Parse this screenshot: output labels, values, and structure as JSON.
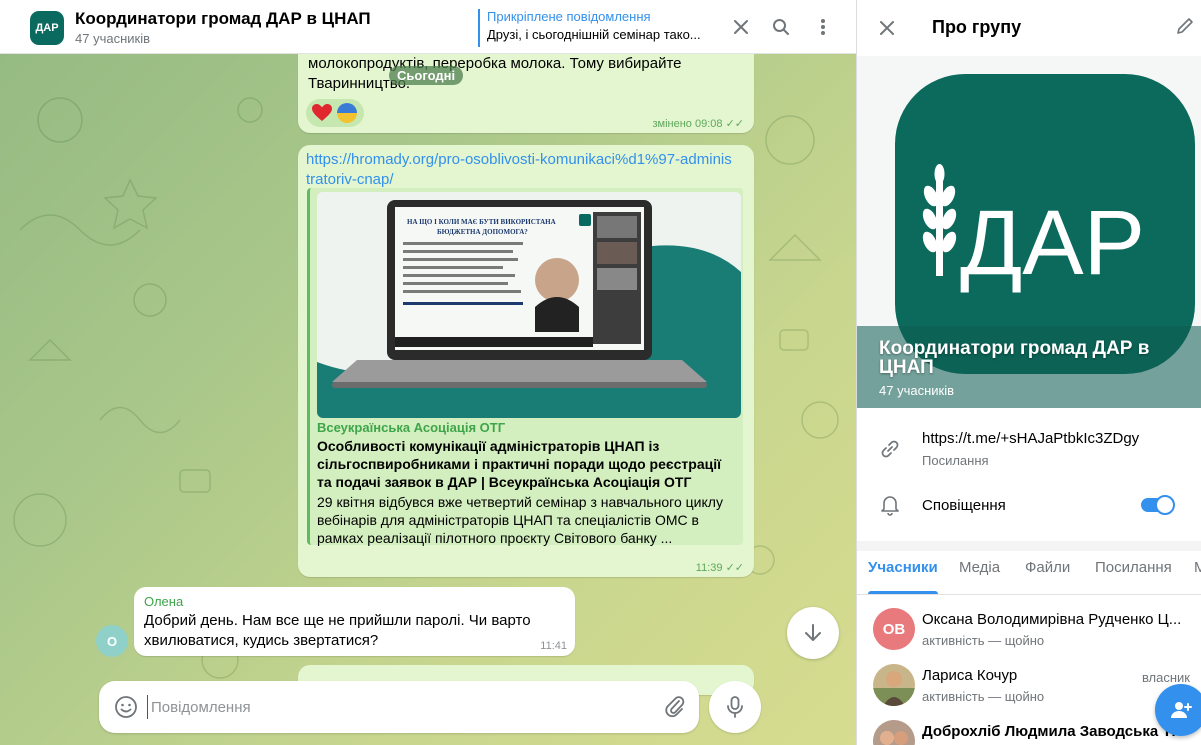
{
  "header": {
    "avatar_text": "ДАР",
    "title": "Координатори громад ДАР в ЦНАП",
    "subtitle": "47 учасників",
    "pinned_title": "Прикріплене повідомлення",
    "pinned_text": "Друзі, і сьогоднішній семінар тако..."
  },
  "chat": {
    "date_divider": "Сьогодні",
    "msg1": {
      "text_line1": "молокопродуктів, переробка молока. Тому вибирайте",
      "text_line2": "Тваринництво.",
      "meta": "змінено 09:08",
      "reactions": [
        "heart",
        "ukraine-flag-ball"
      ]
    },
    "msg2": {
      "link_line1": "https://hromady.org/pro-osoblivosti-komunikaci%d1%97-adminis",
      "link_line2": "tratoriv-cnap/",
      "preview_site": "Всеукраїнська Асоціація ОТГ",
      "preview_title": "Особливості комунікації адміністраторів ЦНАП із сільгоспвиробниками і практичні поради щодо реєстрації та подачі заявок в ДАР | Всеукраїнська Асоціація ОТГ",
      "preview_desc": "29 квітня відбувся вже четвертий семінар з навчального циклу вебінарів для адміністраторів ЦНАП та спеціалістів ОМС в рамках реалізації пілотного проєкту Світового банку ...",
      "image_heading": "НА ЩО І КОЛИ МАЄ БУТИ ВИКОРИСТАНА БЮДЖЕТНА ДОПОМОГА?",
      "meta": "11:39"
    },
    "msg3": {
      "sender": "Олена",
      "avatar_letter": "О",
      "text_line1": "Добрий день.  Нам все ще не прийшли паролі. Чи варто",
      "text_line2": "хвилюватися, кудись звертатися?",
      "time": "11:41"
    }
  },
  "composer": {
    "placeholder": "Повідомлення"
  },
  "panel": {
    "title": "Про групу",
    "hero_logo_text": "ДАР",
    "hero_name": "Координатори громад ДАР в ЦНАП",
    "hero_count": "47 учасників",
    "link_value": "https://t.me/+sHAJaPtbkIc3ZDgy",
    "link_label": "Посилання",
    "notifications_label": "Сповіщення",
    "notifications_on": true,
    "tabs": [
      "Учасники",
      "Медіа",
      "Файли",
      "Посилання",
      "М"
    ],
    "members": [
      {
        "name": "Оксана Володимирівна Рудченко Ц...",
        "status": "активність — щойно",
        "initials": "ОВ",
        "role": ""
      },
      {
        "name": "Лариса Кочур",
        "status": "активність — щойно",
        "initials": "",
        "role": "власник"
      },
      {
        "name": "Доброхліб Людмила Заводська ТГ",
        "status": "",
        "initials": "",
        "role": ""
      }
    ]
  },
  "colors": {
    "accent": "#3390ec",
    "bubble_out": "#e3f6cf",
    "brand_green": "#0b6a5f"
  }
}
